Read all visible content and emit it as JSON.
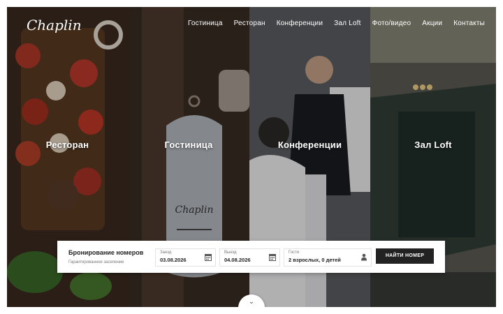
{
  "logo": {
    "text": "Chaplin"
  },
  "nav": {
    "items": [
      {
        "label": "Гостиница"
      },
      {
        "label": "Ресторан"
      },
      {
        "label": "Конференции"
      },
      {
        "label": "Зал Loft"
      },
      {
        "label": "Фото/видео"
      },
      {
        "label": "Акции"
      },
      {
        "label": "Контакты"
      }
    ]
  },
  "panels": [
    {
      "label": "Ресторан"
    },
    {
      "label": "Гостиница"
    },
    {
      "label": "Конференции"
    },
    {
      "label": "Зал Loft"
    }
  ],
  "booking": {
    "title": "Бронирование номеров",
    "subtitle": "Гарантированное заселение",
    "checkin": {
      "label": "Заезд",
      "value": "03.08.2026",
      "icon": "calendar-icon"
    },
    "checkout": {
      "label": "Выезд",
      "value": "04.08.2026",
      "icon": "calendar-icon"
    },
    "guests": {
      "label": "Гости",
      "value": "2 взрослых, 0 детей",
      "icon": "person-icon"
    },
    "submit_label": "НАЙТИ НОМЕР"
  },
  "scroll": {
    "icon": "chevron-down-icon",
    "glyph": "⌄"
  }
}
